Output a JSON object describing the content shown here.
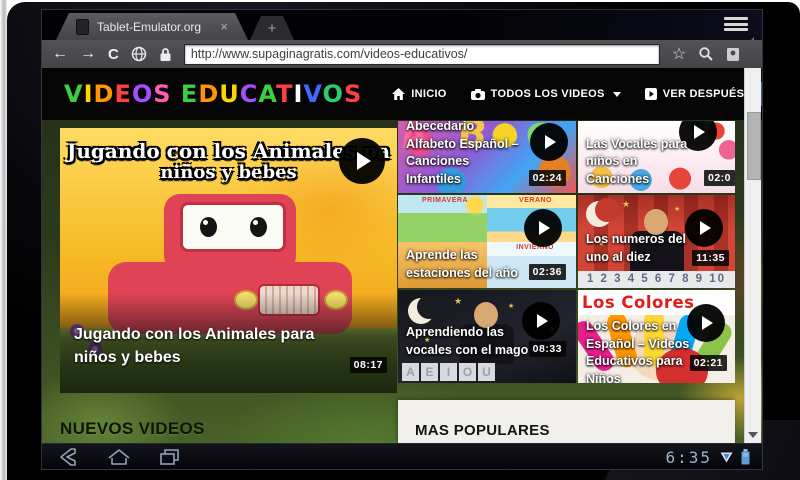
{
  "browser": {
    "tab": {
      "title": "Tablet-Emulator.org",
      "close_label": "×",
      "new_tab_label": "+"
    },
    "url": "http://www.supaginagratis.com/videos-educativos/"
  },
  "site": {
    "logo_text": "VIDEOS EDUCATIVOS",
    "logo_letters": [
      {
        "ch": "V",
        "color": "#3ecf3e"
      },
      {
        "ch": "I",
        "color": "#ffd400"
      },
      {
        "ch": "D",
        "color": "#ff9500"
      },
      {
        "ch": "E",
        "color": "#ff4040"
      },
      {
        "ch": "O",
        "color": "#a64dff"
      },
      {
        "ch": "S",
        "color": "#ff5db1"
      },
      {
        "ch": " ",
        "color": "#000000"
      },
      {
        "ch": "E",
        "color": "#3ecf3e"
      },
      {
        "ch": "D",
        "color": "#ff9500"
      },
      {
        "ch": "U",
        "color": "#ffd400"
      },
      {
        "ch": "C",
        "color": "#a64dff"
      },
      {
        "ch": "A",
        "color": "#3ecf3e"
      },
      {
        "ch": "T",
        "color": "#ff4040"
      },
      {
        "ch": "I",
        "color": "#ffffff"
      },
      {
        "ch": "V",
        "color": "#4169ff"
      },
      {
        "ch": "O",
        "color": "#2ecc71"
      },
      {
        "ch": "S",
        "color": "#ff4040"
      }
    ],
    "nav": [
      {
        "label": "INICIO"
      },
      {
        "label": "TODOS LOS VIDEOS"
      },
      {
        "label": "VER DESPUÉS"
      }
    ]
  },
  "featured": {
    "image_title_line1": "Jugando con los Animales pa",
    "image_title_line2": "niños y bebes",
    "title": "Jugando con los Animales para niños y bebes",
    "duration": "08:17"
  },
  "videos": [
    {
      "title": "Abecedario Alfabeto Español – Canciones Infantiles",
      "duration": "02:24"
    },
    {
      "title": "Las Vocales para niños en Canciones",
      "duration": "02:0"
    },
    {
      "title": "Aprende las estaciones del año",
      "duration": "02:36"
    },
    {
      "title": "Los numeros del uno al diez",
      "duration": "11:35"
    },
    {
      "title": "Aprendiendo las vocales con el mago",
      "duration": "08:33"
    },
    {
      "title": "Los Colores en Español – Videos Educativos para Niños",
      "duration": "02:21"
    }
  ],
  "thumbnails": {
    "abc_letters": [
      "A",
      "B",
      "C"
    ],
    "estaciones_labels": [
      "PRIMAVERA",
      "VERANO",
      "INVIERNO"
    ],
    "numeros_strip": "1 2 3 4 5 6 7 8 9 10",
    "mago_letters": [
      "A",
      "E",
      "I",
      "O",
      "U"
    ],
    "colores_text": "Los Colores"
  },
  "sections": {
    "new_videos": "NUEVOS VIDEOS",
    "most_popular": "MAS POPULARES"
  },
  "statusbar": {
    "time": "6:35"
  },
  "colors": {
    "facebook": "#39579a",
    "twitter": "#4fc0e8",
    "header_bg": "#050505",
    "toolbar_bg": "#4a4a4e",
    "colores_red": "#e21b1b"
  }
}
